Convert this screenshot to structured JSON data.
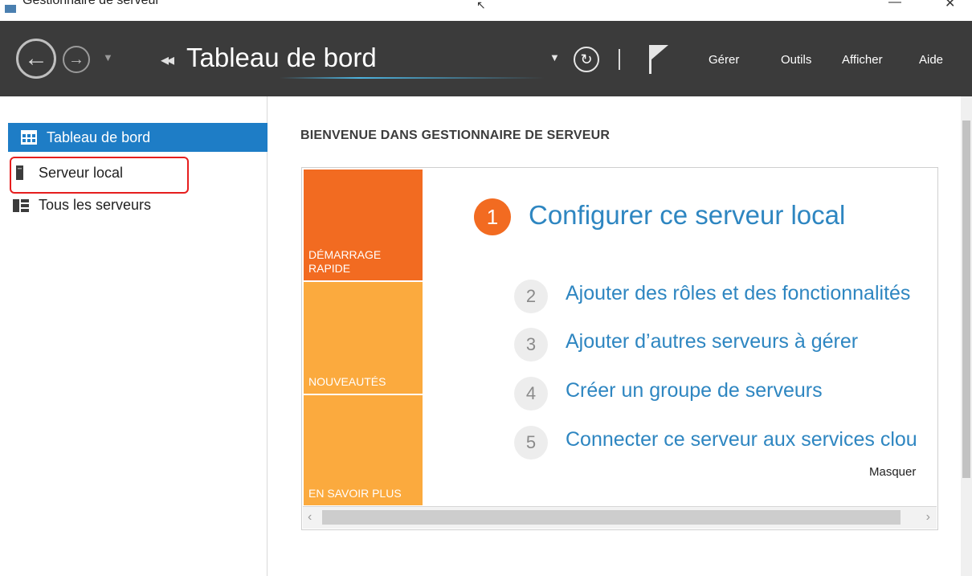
{
  "window": {
    "title": "Gestionnaire de serveur",
    "min_glyph": "—",
    "close_glyph": "✕"
  },
  "header": {
    "breadcrumb_arrows": "◂◂",
    "page_title": "Tableau de bord",
    "menu": [
      "Gérer",
      "Outils",
      "Afficher",
      "Aide"
    ],
    "icons": [
      "back-arrow-icon",
      "forward-arrow-icon",
      "refresh-icon",
      "flag-icon"
    ]
  },
  "sidebar": {
    "items": [
      {
        "label": "Tableau de bord",
        "icon": "dashboard-grid-icon",
        "active": true
      },
      {
        "label": "Serveur local",
        "icon": "server-icon",
        "active": false,
        "highlighted": true
      },
      {
        "label": "Tous les serveurs",
        "icon": "servers-icon",
        "active": false
      }
    ]
  },
  "main": {
    "welcome_title": "BIENVENUE DANS GESTIONNAIRE DE SERVEUR",
    "tiles": [
      {
        "label": "DÉMARRAGE RAPIDE",
        "color": "#f26b21"
      },
      {
        "label": "NOUVEAUTÉS",
        "color": "#fbaa3e"
      },
      {
        "label": "EN SAVOIR PLUS",
        "color": "#fbaa3e"
      }
    ],
    "steps": [
      {
        "number": "1",
        "label": "Configurer ce serveur local"
      },
      {
        "number": "2",
        "label": "Ajouter des rôles et des fonctionnalités"
      },
      {
        "number": "3",
        "label": "Ajouter d’autres serveurs à gérer"
      },
      {
        "number": "4",
        "label": "Créer un groupe de serveurs"
      },
      {
        "number": "5",
        "label": "Connecter ce serveur aux services clou"
      }
    ],
    "hide_label": "Masquer"
  },
  "colors": {
    "header_bg": "#3b3b3b",
    "accent_blue": "#1e7dc6",
    "link_blue": "#2e86c1",
    "orange": "#f26b21",
    "light_orange": "#fbaa3e",
    "highlight_red": "#e61e1e"
  }
}
